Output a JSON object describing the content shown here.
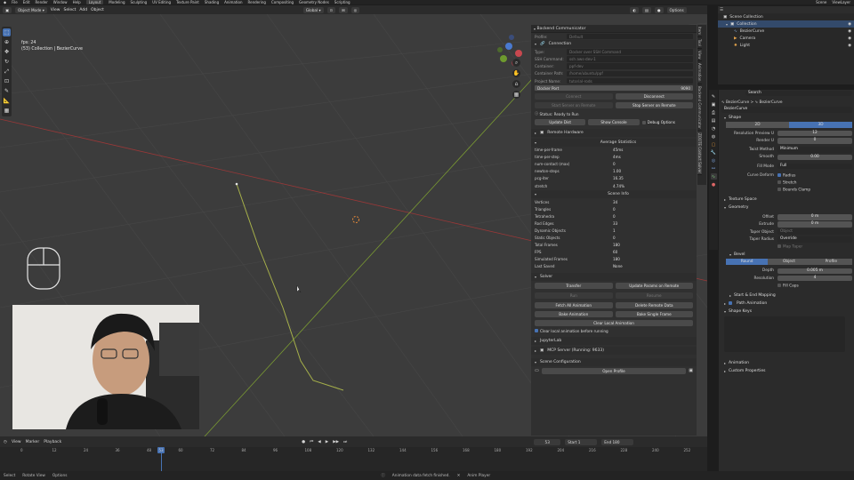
{
  "menubar": {
    "menus": [
      "File",
      "Edit",
      "Render",
      "Window",
      "Help"
    ],
    "workspaces": [
      "Layout",
      "Modeling",
      "Sculpting",
      "UV Editing",
      "Texture Paint",
      "Shading",
      "Animation",
      "Rendering",
      "Compositing",
      "Geometry Nodes",
      "Scripting"
    ],
    "active_workspace": "Layout",
    "scene": "Scene",
    "view_layer": "ViewLayer"
  },
  "viewport_header": {
    "mode": "Object Mode",
    "menus": [
      "View",
      "Select",
      "Add",
      "Object"
    ],
    "orientation": "Global",
    "options": "Options"
  },
  "viewport": {
    "fps": "fps: 24",
    "context": "(53) Collection | BezierCurve"
  },
  "sidetabs": [
    "Item",
    "Tool",
    "View",
    "Animation",
    "Backend Communicator",
    "ZOOTE Contact Solver"
  ],
  "npanel": {
    "title": "Backend Communicator",
    "profile_label": "Profile:",
    "profile_value": "Default",
    "connection": "Connection",
    "fields": [
      {
        "label": "Type:",
        "value": "Docker over SSH Command"
      },
      {
        "label": "SSH Command:",
        "value": "ssh aws-dev-1"
      },
      {
        "label": "Container:",
        "value": "ppf-dev"
      },
      {
        "label": "Container Path:",
        "value": "/home/ubuntu/ppf"
      },
      {
        "label": "Project Name:",
        "value": "tutorial-rods"
      }
    ],
    "docker_port_label": "Docker Port",
    "docker_port_value": "9090",
    "connect": "Connect",
    "disconnect": "Disconnect",
    "start_server": "Start Server on Remote",
    "stop_server": "Stop Server on Remote",
    "status": "Status: Ready to Run",
    "update_dist": "Update Dist",
    "show_console": "Show Console",
    "debug_options": "Debug Options",
    "remote_hardware": "Remote Hardware",
    "average_statistics": "Average Statistics",
    "stats": [
      {
        "k": "time-per-frame",
        "v": "45ms"
      },
      {
        "k": "time-per-step",
        "v": "4ms"
      },
      {
        "k": "num-contact (max)",
        "v": "0"
      },
      {
        "k": "newton-steps",
        "v": "1.00"
      },
      {
        "k": "pcg-iter",
        "v": "16.35"
      },
      {
        "k": "stretch",
        "v": "4.74%"
      }
    ],
    "scene_info": "Scene Info",
    "scene_stats": [
      {
        "k": "Vertices",
        "v": "34"
      },
      {
        "k": "Triangles",
        "v": "0"
      },
      {
        "k": "Tetrahedra",
        "v": "0"
      },
      {
        "k": "Rod Edges",
        "v": "33"
      },
      {
        "k": "Dynamic Objects",
        "v": "1"
      },
      {
        "k": "Static Objects",
        "v": "0"
      },
      {
        "k": "Total Frames",
        "v": "180"
      },
      {
        "k": "FPS",
        "v": "60"
      },
      {
        "k": "Simulated Frames",
        "v": "180"
      },
      {
        "k": "Last Saved",
        "v": "None"
      }
    ],
    "solver": "Solver",
    "transfer": "Transfer",
    "update_params": "Update Params on Remote",
    "run": "Run",
    "resume": "Resume",
    "fetch_all": "Fetch All Animation",
    "delete_remote": "Delete Remote Data",
    "bake_animation": "Bake Animation",
    "bake_single": "Bake Single Frame",
    "clear_local": "Clear Local Animation",
    "clear_before": "Clear local animation before running",
    "jupyterlab": "JupyterLab",
    "mcp": "MCP Server (Running: 9633)",
    "scene_configuration": "Scene Configuration",
    "open_profile": "Open Profile"
  },
  "outliner": {
    "root": "Scene Collection",
    "collection": "Collection",
    "items": [
      "BezierCurve",
      "Camera",
      "Light"
    ]
  },
  "properties": {
    "search_placeholder": "Search",
    "breadcrumb_obj": "BezierCurve",
    "breadcrumb_data": "BezierCurve",
    "datablock": "BezierCurve",
    "shape": "Shape",
    "dim_2d": "2D",
    "dim_3d": "3D",
    "res_preview_label": "Resolution Preview U",
    "res_preview": "12",
    "render_u_label": "Render U",
    "render_u": "0",
    "twist_method_label": "Twist Method",
    "twist_method": "Minimum",
    "smooth_label": "Smooth",
    "smooth": "0.00",
    "fill_mode_label": "Fill Mode",
    "fill_mode": "Full",
    "curve_deform_label": "Curve Deform",
    "radius": "Radius",
    "stretch": "Stretch",
    "bounds_clamp": "Bounds Clamp",
    "texture_space": "Texture Space",
    "geometry": "Geometry",
    "offset_label": "Offset",
    "offset": "0 m",
    "extrude_label": "Extrude",
    "extrude": "0 m",
    "taper_object_label": "Taper Object",
    "taper_object_placeholder": "Object",
    "taper_radius_label": "Taper Radius",
    "taper_radius": "Override",
    "map_taper": "Map Taper",
    "bevel": "Bevel",
    "bevel_round": "Round",
    "bevel_object": "Object",
    "bevel_profile": "Profile",
    "depth_label": "Depth",
    "depth": "0.005 m",
    "resolution_label": "Resolution",
    "resolution": "4",
    "fill_caps": "Fill Caps",
    "start_end": "Start & End Mapping",
    "path_animation": "Path Animation",
    "shape_keys": "Shape Keys",
    "animation": "Animation",
    "custom_properties": "Custom Properties"
  },
  "timeline": {
    "menus": [
      "View",
      "Marker",
      "Playback"
    ],
    "current_frame": "53",
    "start_label": "Start",
    "start": "1",
    "end_label": "End",
    "end": "180",
    "ticks": [
      "0",
      "12",
      "24",
      "36",
      "48",
      "60",
      "72",
      "84",
      "96",
      "108",
      "120",
      "132",
      "144",
      "156",
      "168",
      "180",
      "192",
      "204",
      "216",
      "228",
      "240",
      "252"
    ]
  },
  "statusbar": {
    "select": "Select",
    "rotate": "Rotate View",
    "options": "Options",
    "message": "Animation data fetch finished.",
    "anim_player": "Anim Player"
  },
  "colors": {
    "accent": "#4772b3",
    "x_axis": "#b43c3c",
    "y_axis": "#8aa63a",
    "curve": "#a6b04a"
  }
}
